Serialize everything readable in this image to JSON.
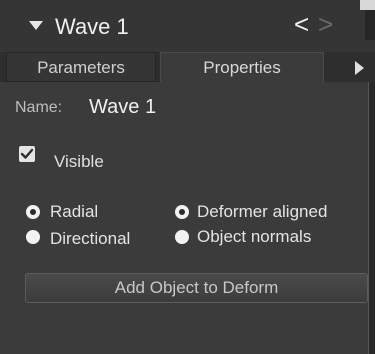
{
  "title": "Wave 1",
  "tabs": [
    {
      "label": "Parameters",
      "active": false
    },
    {
      "label": "Properties",
      "active": true
    }
  ],
  "properties": {
    "name_label": "Name:",
    "name_value": "Wave 1",
    "visible_label": "Visible",
    "visible_checked": true,
    "mode_options": [
      {
        "label": "Radial",
        "selected": true
      },
      {
        "label": "Directional",
        "selected": false
      }
    ],
    "alignment_options": [
      {
        "label": "Deformer aligned",
        "selected": true
      },
      {
        "label": "Object normals",
        "selected": false
      }
    ],
    "add_button_label": "Add Object to Deform"
  },
  "colors": {
    "panel_bg": "#3b3b3b",
    "title_bg": "#353535",
    "text": "#f0f0f0",
    "muted_text": "#bdbdbd"
  },
  "icons": {
    "collapse": "triangle-down-icon",
    "back": "chevron-left-icon",
    "forward": "chevron-right-icon",
    "tab_scroll": "triangle-right-icon"
  }
}
